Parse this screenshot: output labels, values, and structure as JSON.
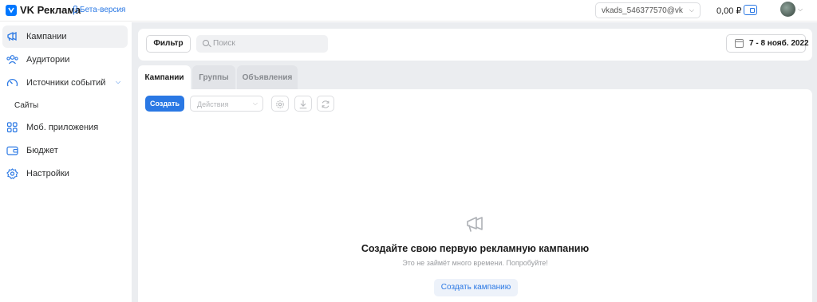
{
  "header": {
    "logo_text": "VK Реклама",
    "beta_symbol": "β",
    "beta_label": "Бета-версия",
    "account": "vkads_546377570@vk",
    "balance": "0,00 ₽"
  },
  "sidebar": {
    "items": [
      {
        "label": "Кампании",
        "icon": "megaphone-icon",
        "active": true
      },
      {
        "label": "Аудитории",
        "icon": "users-icon"
      },
      {
        "label": "Источники событий",
        "icon": "gauge-icon",
        "expandable": true
      },
      {
        "label": "Сайты",
        "sub": true
      },
      {
        "label": "Моб. приложения",
        "icon": "apps-grid-icon"
      },
      {
        "label": "Бюджет",
        "icon": "wallet-icon"
      },
      {
        "label": "Настройки",
        "icon": "gear-icon"
      }
    ]
  },
  "toolbar": {
    "filter_label": "Фильтр",
    "search_placeholder": "Поиск",
    "date_range": "7 - 8 нояб. 2022"
  },
  "tabs": [
    {
      "label": "Кампании",
      "active": true
    },
    {
      "label": "Группы"
    },
    {
      "label": "Объявления"
    }
  ],
  "content": {
    "create_label": "Создать",
    "actions_placeholder": "Действия",
    "empty_title": "Создайте свою первую рекламную кампанию",
    "empty_subtitle": "Это не займёт много времени. Попробуйте!",
    "empty_button": "Создать кампанию"
  },
  "colors": {
    "accent": "#2a78e4",
    "main_bg": "#ebedf0"
  }
}
